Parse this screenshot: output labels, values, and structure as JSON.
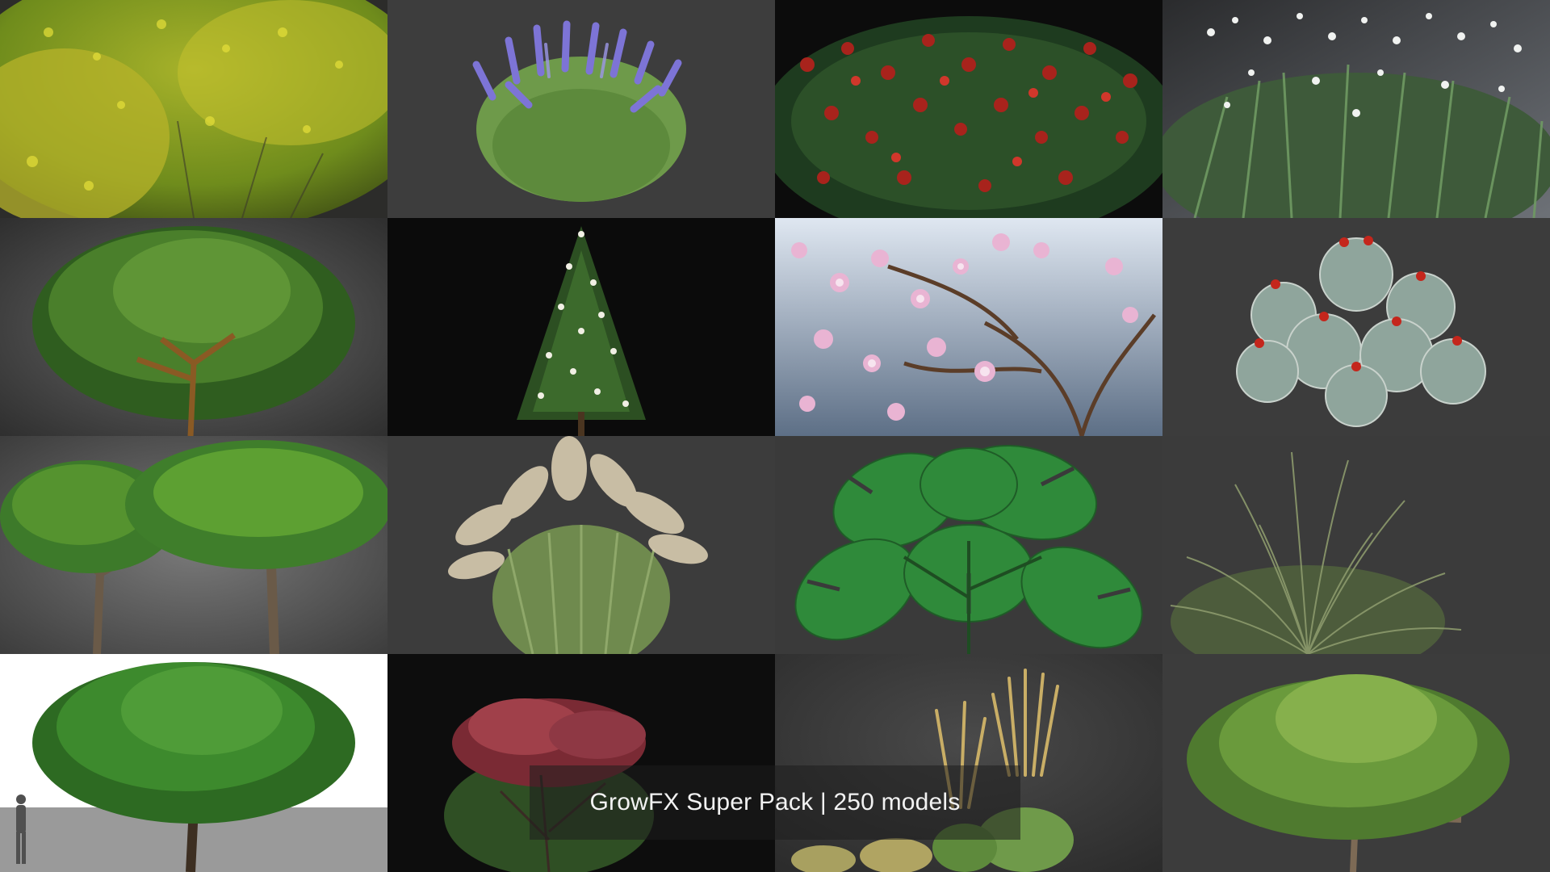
{
  "caption": {
    "text": "GrowFX Super Pack | 250 models"
  },
  "tiles": [
    {
      "row": 1,
      "col": 1,
      "subject": "yellow-flowering-shrub",
      "background": "#2c2c2a"
    },
    {
      "row": 1,
      "col": 2,
      "subject": "lavender-flowering-plant",
      "background": "#3d3d3d"
    },
    {
      "row": 1,
      "col": 3,
      "subject": "red-berry-shrub",
      "background": "#0c0c0c"
    },
    {
      "row": 1,
      "col": 4,
      "subject": "white-flowering-grass",
      "background": "#3c3d3f"
    },
    {
      "row": 2,
      "col": 1,
      "subject": "spreading-green-tree",
      "background": "#3e3e3e"
    },
    {
      "row": 2,
      "col": 2,
      "subject": "conical-flowering-tree",
      "background": "#0b0b0b"
    },
    {
      "row": 2,
      "col": 3,
      "subject": "pink-magnolia-branches",
      "background": "#a9b6c4"
    },
    {
      "row": 2,
      "col": 4,
      "subject": "round-cactus-cluster",
      "background": "#3c3c3c"
    },
    {
      "row": 3,
      "col": 1,
      "subject": "twin-green-trees",
      "background": "#555555"
    },
    {
      "row": 3,
      "col": 2,
      "subject": "pampas-grass",
      "background": "#3c3c3c"
    },
    {
      "row": 3,
      "col": 3,
      "subject": "monstera-plant",
      "background": "#3a3a3a"
    },
    {
      "row": 3,
      "col": 4,
      "subject": "fine-ornamental-grass",
      "background": "#3b3b3b"
    },
    {
      "row": 4,
      "col": 1,
      "subject": "large-tree-with-human-silhouette",
      "background": "#ffffff"
    },
    {
      "row": 4,
      "col": 2,
      "subject": "red-leaf-shrub",
      "background": "#0d0d0d"
    },
    {
      "row": 4,
      "col": 3,
      "subject": "feather-reed-grasses",
      "background": "#333333"
    },
    {
      "row": 4,
      "col": 4,
      "subject": "broad-canopy-tree",
      "background": "#3c3c3c"
    }
  ]
}
